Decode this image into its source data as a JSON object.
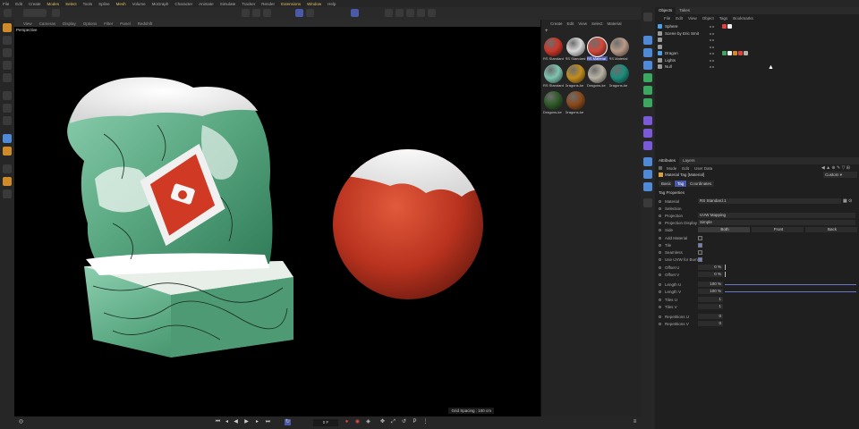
{
  "menubar": [
    "File",
    "Edit",
    "Create",
    "Modes",
    "Select",
    "Tools",
    "Spline",
    "Mesh",
    "Volume",
    "MoGraph",
    "Character",
    "Animate",
    "Simulate",
    "Tracker",
    "Render",
    "Extensions",
    "Window",
    "Help"
  ],
  "menubar_highlight": [
    "Modes",
    "Select",
    "Mesh",
    "Extensions",
    "Window"
  ],
  "viewport": {
    "menu": [
      "View",
      "Cameras",
      "Display",
      "Options",
      "Filter",
      "Panel",
      "Redshift"
    ],
    "label": "Perspective",
    "grid_spacing": "Grid Spacing : 100 cm"
  },
  "timeline": {
    "frame": "0 F"
  },
  "materials": {
    "menu": [
      "Create",
      "Edit",
      "View",
      "Select",
      "Material"
    ],
    "items": [
      {
        "label": "RS Standard",
        "color": "#c9372a",
        "selected": false
      },
      {
        "label": "RS Standard",
        "color": "#d8d8d8",
        "selected": false
      },
      {
        "label": "RS Material",
        "color": "#d0483a",
        "selected": true
      },
      {
        "label": "RS Material",
        "color": "#b89a88",
        "selected": false
      },
      {
        "label": "RS Standard",
        "color": "#7ec4b0",
        "selected": false
      },
      {
        "label": "Dragons-ke",
        "color": "#c28c1e",
        "selected": false
      },
      {
        "label": "Dragons-ke",
        "color": "#b8b2a4",
        "selected": false
      },
      {
        "label": "Dragons-ke",
        "color": "#1e8c7c",
        "selected": false
      },
      {
        "label": "Dragons-ke",
        "color": "#2e5a28",
        "selected": false
      },
      {
        "label": "Dragons-ke",
        "color": "#8a4a1c",
        "selected": false
      }
    ]
  },
  "objects": {
    "tabs": [
      "Objects",
      "Takes"
    ],
    "menu": [
      "File",
      "Edit",
      "View",
      "Object",
      "Tags",
      "Bookmarks"
    ],
    "rows": [
      {
        "name": "Sphere",
        "icon": "#4ea0e8"
      },
      {
        "name": "Scene by Eric Smit",
        "icon": "#9a9a9a"
      },
      {
        "name": "",
        "icon": "#9a9a9a"
      },
      {
        "name": "",
        "icon": "#9a9a9a"
      },
      {
        "name": "Dragon",
        "icon": "#4ea0e8"
      },
      {
        "name": "Lights",
        "icon": "#9a9a9a"
      },
      {
        "name": "Null",
        "icon": "#9a9a9a"
      }
    ]
  },
  "attributes": {
    "tabs": [
      "Attributes",
      "Layers"
    ],
    "menu": [
      "Mode",
      "Edit",
      "User Data"
    ],
    "title": "Material Tag [Material]",
    "preset": "Custom",
    "subtabs": [
      "Basic",
      "Tag",
      "Coordinates"
    ],
    "section": "Tag Properties",
    "material_label": "Material",
    "material_value": "RS Standard.1",
    "selection_label": "Selection",
    "projection_label": "Projection",
    "projection_value": "UVW Mapping",
    "projdisplay_label": "Projection Display",
    "projdisplay_value": "Simple",
    "side_label": "Side",
    "side_options": [
      "Both",
      "Front",
      "Back"
    ],
    "add_material_label": "Add Material",
    "tile_label": "Tile",
    "seamless_label": "Seamless",
    "use_uvw_label": "Use UVW for Bump",
    "offset_u_label": "Offset U",
    "offset_u": "0 %",
    "offset_v_label": "Offset V",
    "offset_v": "0 %",
    "length_u_label": "Length U",
    "length_u": "100 %",
    "length_v_label": "Length V",
    "length_v": "100 %",
    "tiles_u_label": "Tiles U",
    "tiles_u": "1",
    "tiles_v_label": "Tiles V",
    "tiles_v": "1",
    "rep_u_label": "Repetitions U",
    "rep_u": "0",
    "rep_v_label": "Repetitions V",
    "rep_v": "0"
  }
}
